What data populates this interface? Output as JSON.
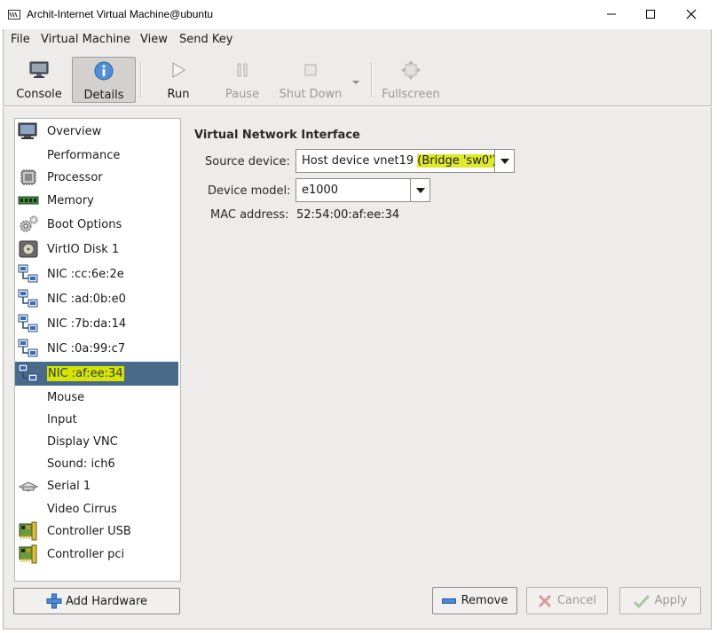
{
  "window": {
    "title": "Archit-Internet Virtual Machine@ubuntu"
  },
  "menu": {
    "file": "File",
    "virtual_machine": "Virtual Machine",
    "view": "View",
    "send_key": "Send Key"
  },
  "toolbar": {
    "console": "Console",
    "details": "Details",
    "run": "Run",
    "pause": "Pause",
    "shut_down": "Shut Down",
    "fullscreen": "Fullscreen"
  },
  "sidebar": {
    "items": [
      {
        "label": "Overview",
        "icon": "monitor-icon"
      },
      {
        "label": "Performance",
        "icon": ""
      },
      {
        "label": "Processor",
        "icon": "cpu-chip-icon"
      },
      {
        "label": "Memory",
        "icon": "memory-module-icon"
      },
      {
        "label": "Boot Options",
        "icon": "gears-icon"
      },
      {
        "label": "VirtIO Disk 1",
        "icon": "hard-disk-icon"
      },
      {
        "label": "NIC :cc:6e:2e",
        "icon": "network-icon"
      },
      {
        "label": "NIC :ad:0b:e0",
        "icon": "network-icon"
      },
      {
        "label": "NIC :7b:da:14",
        "icon": "network-icon"
      },
      {
        "label": "NIC :0a:99:c7",
        "icon": "network-icon"
      },
      {
        "label": "NIC :af:ee:34",
        "icon": "network-icon"
      },
      {
        "label": "Mouse",
        "icon": ""
      },
      {
        "label": "Input",
        "icon": ""
      },
      {
        "label": "Display VNC",
        "icon": ""
      },
      {
        "label": "Sound: ich6",
        "icon": ""
      },
      {
        "label": "Serial 1",
        "icon": "serial-device-icon"
      },
      {
        "label": "Video Cirrus",
        "icon": ""
      },
      {
        "label": "Controller USB",
        "icon": "pci-card-icon"
      },
      {
        "label": "Controller pci",
        "icon": "pci-card-icon"
      }
    ],
    "selected": "NIC :af:ee:34"
  },
  "details": {
    "heading": "Virtual Network Interface",
    "source_device_label": "Source device:",
    "source_device_value": "Host device vnet19",
    "source_device_bridge": "(Bridge 'sw0')",
    "device_model_label": "Device model:",
    "device_model_value": "e1000",
    "mac_label": "MAC address:",
    "mac_value": "52:54:00:af:ee:34"
  },
  "buttons": {
    "add_hardware": "Add Hardware",
    "remove": "Remove",
    "cancel": "Cancel",
    "apply": "Apply"
  },
  "colors": {
    "selection_bg": "#4a6a8a",
    "highlight": "#d6e400",
    "panel_bg": "#edecea"
  }
}
